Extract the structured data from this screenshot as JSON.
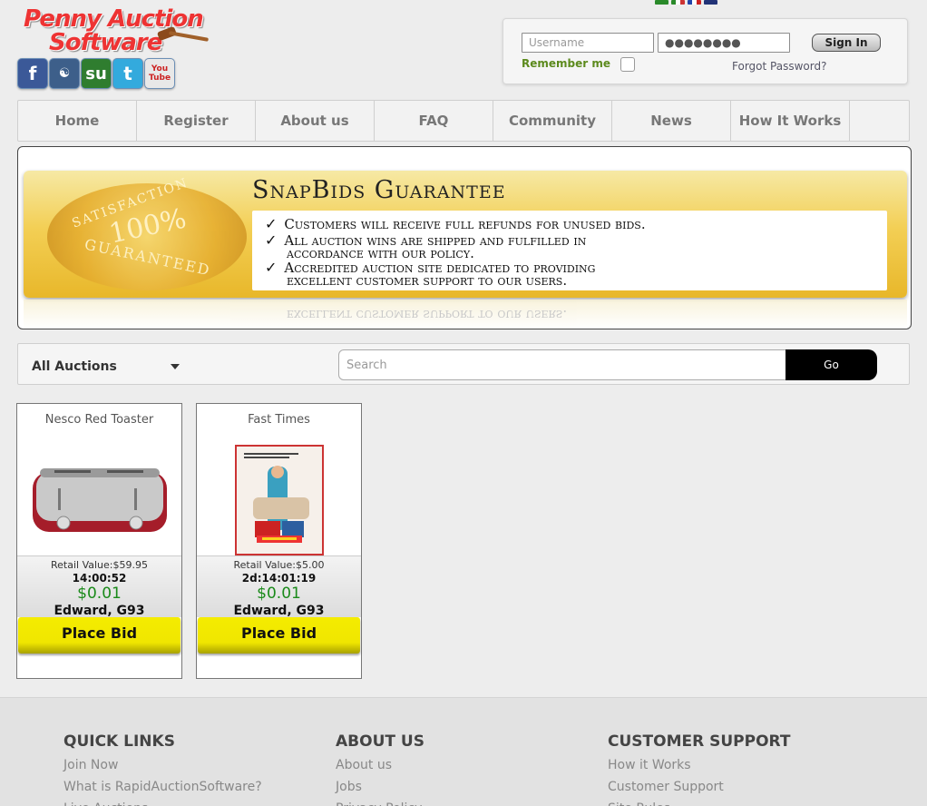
{
  "brand": {
    "line1": "Penny Auction",
    "line2": "Software"
  },
  "social": [
    {
      "icon": "facebook-icon",
      "glyph": "f",
      "color": "#3b5998"
    },
    {
      "icon": "myspace-icon",
      "glyph": "m",
      "color": "#3d5f8a"
    },
    {
      "icon": "stumbleupon-icon",
      "glyph": "su",
      "color": "#3b8a3a"
    },
    {
      "icon": "twitter-icon",
      "glyph": "t",
      "color": "#33aadd"
    },
    {
      "icon": "youtube-icon",
      "glyph": "You Tube",
      "color": "#cc2222"
    }
  ],
  "flags": [
    {
      "icon": "flag-brazil-icon",
      "color": "#2a8a2a"
    },
    {
      "icon": "flag-italy-icon",
      "color": "#cc3333"
    },
    {
      "icon": "flag-france-icon",
      "color": "#2244aa"
    },
    {
      "icon": "flag-uk-icon",
      "color": "#223377"
    }
  ],
  "login": {
    "username_placeholder": "Username",
    "password_value": "●●●●●●●●",
    "signin_label": "Sign In",
    "remember_label": "Remember me",
    "forgot_label": "Forgot Password?"
  },
  "nav": [
    "Home",
    "Register",
    "About us",
    "FAQ",
    "Community",
    "News",
    "How It Works",
    ""
  ],
  "banner": {
    "title": "SnapBids Guarantee",
    "seal_center": "100%",
    "seal_top": "SATISFACTION",
    "seal_bottom": "GUARANTEED",
    "lines": [
      "Customers will receive full refunds for unused bids.",
      "All auction wins are shipped and fulfilled in",
      "accordance with our policy.",
      "Accredited auction site dedicated to providing",
      "excellent customer support to our users."
    ],
    "reflection": "excellent customer support to our users."
  },
  "filter": {
    "category": "All Auctions",
    "search_placeholder": "Search",
    "go_label": "Go"
  },
  "auctions": [
    {
      "title": "Nesco Red Toaster",
      "retail": "Retail Value:$59.95",
      "timer": "14:00:52",
      "price": "$0.01",
      "bidder": "Edward, G93",
      "bid_label": "Place Bid"
    },
    {
      "title": "Fast Times",
      "retail": "Retail Value:$5.00",
      "timer": "2d:14:01:19",
      "price": "$0.01",
      "bidder": "Edward, G93",
      "bid_label": "Place Bid"
    }
  ],
  "footer": {
    "quick_links": {
      "title": "QUICK LINKS",
      "links": [
        "Join Now",
        "What is RapidAuctionSoftware?",
        "Live Auctions"
      ]
    },
    "about": {
      "title": "ABOUT US",
      "links": [
        "About us",
        "Jobs",
        "Privacy Policy"
      ]
    },
    "support": {
      "title": "CUSTOMER SUPPORT",
      "links": [
        "How it Works",
        "Customer Support",
        "Site Rules"
      ]
    }
  }
}
